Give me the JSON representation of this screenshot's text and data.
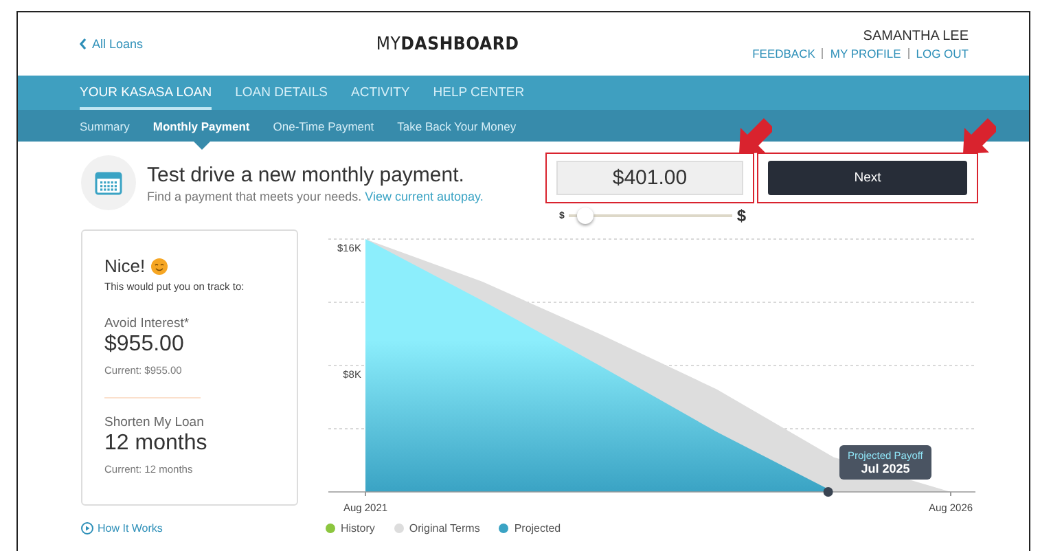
{
  "header": {
    "back_link": "All Loans",
    "logo": {
      "light": "MY",
      "bold": "DASHBOARD"
    },
    "user_name": "SAMANTHA LEE",
    "links": [
      "FEEDBACK",
      "MY PROFILE",
      "LOG OUT"
    ]
  },
  "nav": {
    "tabs": [
      {
        "label": "YOUR KASASA LOAN",
        "selected": true
      },
      {
        "label": "LOAN DETAILS",
        "selected": false
      },
      {
        "label": "ACTIVITY",
        "selected": false
      },
      {
        "label": "HELP CENTER",
        "selected": false
      }
    ]
  },
  "subnav": {
    "tabs": [
      {
        "label": "Summary",
        "selected": false
      },
      {
        "label": "Monthly Payment",
        "selected": true
      },
      {
        "label": "One-Time Payment",
        "selected": false
      },
      {
        "label": "Take Back Your Money",
        "selected": false
      }
    ]
  },
  "intro": {
    "title": "Test drive a new monthly payment.",
    "subtitle": "Find a payment that meets your needs.",
    "link": "View current autopay."
  },
  "payment": {
    "value": "$401.00",
    "highlighted": true,
    "slider": {
      "min_label": "$",
      "max_label": "$",
      "level": 0.1
    },
    "next_button": {
      "label": "Next",
      "highlighted": true
    }
  },
  "summary_card": {
    "heading": "Nice!",
    "lead": "This would put you on track to:",
    "sections": [
      {
        "label": "Avoid Interest*",
        "value": "$955.00",
        "current": "Current: $955.00"
      },
      {
        "label": "Shorten My Loan",
        "value": "12 months",
        "current": "Current: 12 months"
      }
    ]
  },
  "how_it_works": "How It Works",
  "chart": {
    "payoff_tooltip": {
      "title": "Projected Payoff",
      "date": "Jul 2025"
    },
    "chart_data": {
      "type": "area",
      "categories": [
        "Aug 2021",
        null,
        null,
        null,
        null,
        "Aug 2026"
      ],
      "series": [
        {
          "name": "History",
          "color": "#8cc63f",
          "values": [
            null,
            null,
            null,
            null,
            null,
            null
          ]
        },
        {
          "name": "Original Terms",
          "color": "#dddddd",
          "values": [
            16000,
            13300,
            10000,
            6500,
            2200,
            0
          ]
        },
        {
          "name": "Projected",
          "color": "#3aa3c4",
          "values": [
            16000,
            12100,
            8000,
            3800,
            0,
            null
          ]
        }
      ],
      "ylim": [
        0,
        16000
      ],
      "yticks": [
        {
          "value": 8000,
          "label": "$8K"
        },
        {
          "value": 16000,
          "label": "$16K"
        }
      ]
    }
  }
}
